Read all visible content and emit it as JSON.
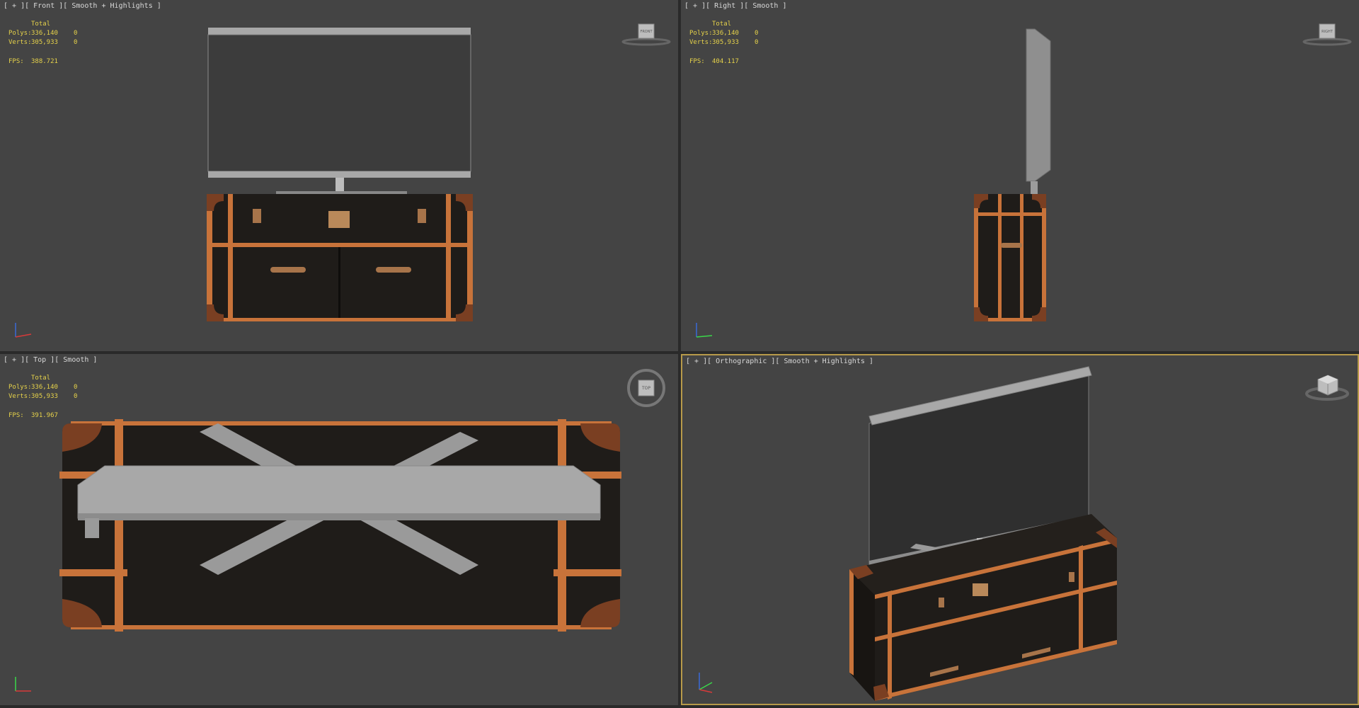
{
  "stats_labels": {
    "total": "Total",
    "polys": "Polys:",
    "verts": "Verts:",
    "fps": "FPS:"
  },
  "viewports": [
    {
      "id": "front",
      "label": "[ + ][ Front ][ Smooth + Highlights ]",
      "polys": "336,140",
      "verts": "305,933",
      "zero": "0",
      "fps": "388.721",
      "cube_label": "FRONT",
      "active": false
    },
    {
      "id": "right",
      "label": "[ + ][ Right ][ Smooth ]",
      "polys": "336,140",
      "verts": "305,933",
      "zero": "0",
      "fps": "404.117",
      "cube_label": "RIGHT",
      "active": false
    },
    {
      "id": "top",
      "label": "[ + ][ Top ][ Smooth ]",
      "polys": "336,140",
      "verts": "305,933",
      "zero": "0",
      "fps": "391.967",
      "cube_label": "TOP",
      "active": false
    },
    {
      "id": "persp",
      "label": "[ + ][ Orthographic ][ Smooth + Highlights ]",
      "polys": "",
      "verts": "",
      "zero": "",
      "fps": "",
      "cube_label": "",
      "active": true
    }
  ],
  "colors": {
    "viewport_bg": "#444444",
    "trunk_body": "#1f1c19",
    "trunk_trim": "#c8733a",
    "leather_corner": "#7a3f22",
    "brass": "#b9895a",
    "screen": "#333333",
    "tv_frame": "#9a9a9a",
    "stats_text": "#e6d24a",
    "active_border": "#b79a4a"
  }
}
